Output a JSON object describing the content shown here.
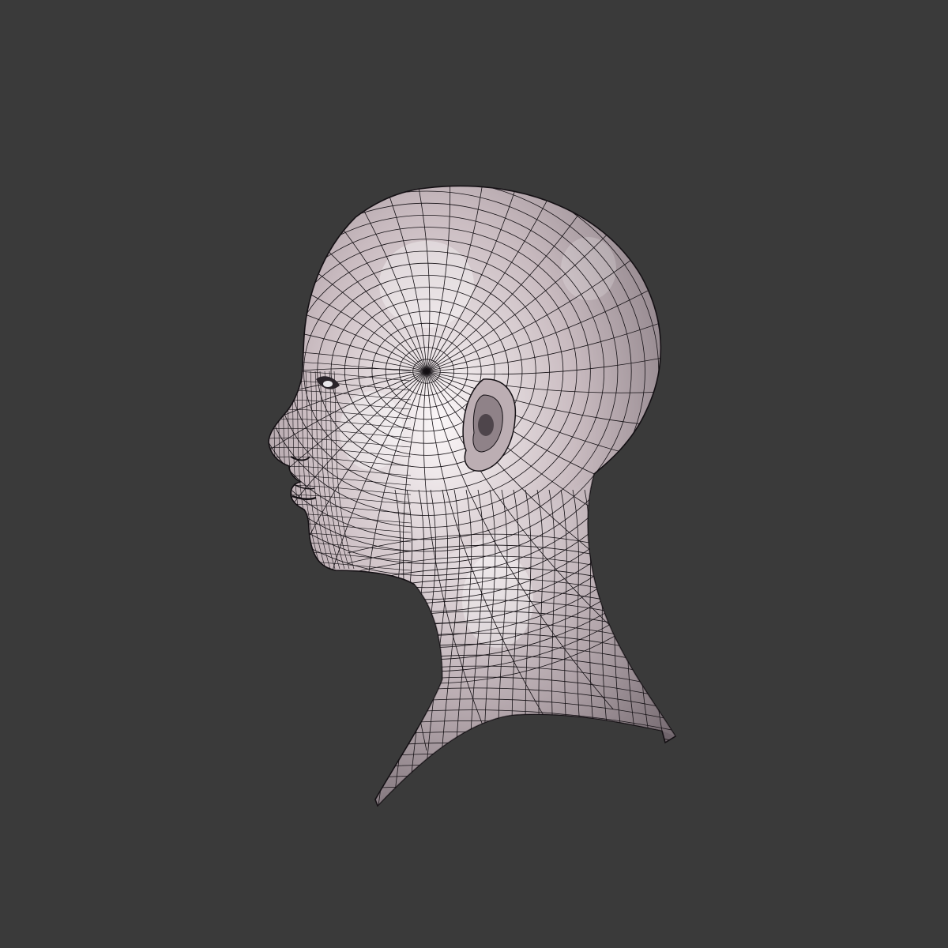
{
  "viewport": {
    "background_color": "#3a3a3a"
  },
  "model": {
    "subject": "head-and-neck-wireframe-mesh",
    "view": "left-profile",
    "surface_color": "#c9bbc0",
    "highlight_color": "#fbf7f8",
    "shadow_color": "#6f646b",
    "wire_color": "#141014"
  }
}
